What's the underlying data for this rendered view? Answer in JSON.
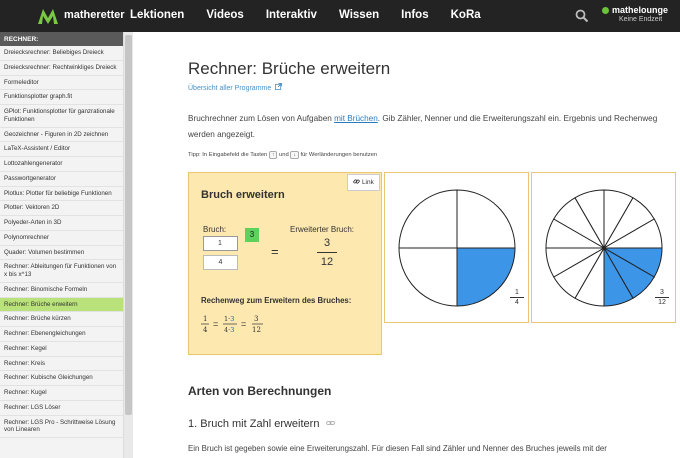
{
  "header": {
    "brand": "matheretter",
    "nav": [
      "Lektionen",
      "Videos",
      "Interaktiv",
      "Wissen",
      "Infos",
      "KoRa"
    ],
    "user_name": "mathelounge",
    "user_status": "Keine Endzeit"
  },
  "sidebar": {
    "heading": "RECHNER:",
    "items": [
      "Dreiecksrechner: Beliebiges Dreieck",
      "Dreiecksrechner: Rechtwinkliges Dreieck",
      "Formeleditor",
      "Funktionsplotter graph.fit",
      "GPlot: Funktionsplotter für ganzrationale Funktionen",
      "Geozeichner - Figuren in 2D zeichnen",
      "LaTeX-Assistent / Editor",
      "Lottozahlengenerator",
      "Passwortgenerator",
      "Plotlux: Plotter für beliebige Funktionen",
      "Plotter: Vektoren 2D",
      "Polyeder-Arten in 3D",
      "Polynomrechner",
      "Quader: Volumen bestimmen",
      "Rechner: Ableitungen für Funktionen von x bis x^13",
      "Rechner: Binomische Formeln",
      "Rechner: Brüche erweitern",
      "Rechner: Brüche kürzen",
      "Rechner: Ebenengleichungen",
      "Rechner: Kegel",
      "Rechner: Kreis",
      "Rechner: Kubische Gleichungen",
      "Rechner: Kugel",
      "Rechner: LGS Löser",
      "Rechner: LGS Pro - Schrittweise Lösung von Linearen"
    ],
    "active_index": 16
  },
  "main": {
    "title": "Rechner: Brüche erweitern",
    "overview_link": "Übersicht aller Programme",
    "intro_before": "Bruchrechner zum Lösen von Aufgaben ",
    "intro_link": "mit Brüchen",
    "intro_after": ". Gib Zähler, Nenner und die Erweiterungszahl ein. Ergebnis und Rechenweg werden angezeigt.",
    "tip_before": "Tipp: In Eingabefeld die Tasten",
    "tip_key_up": "↑",
    "tip_mid": "und",
    "tip_key_down": "↓",
    "tip_after": "für Werländerungen benutzen"
  },
  "calculator": {
    "title": "Bruch erweitern",
    "link_label": "Link",
    "bruch_label": "Bruch:",
    "numerator": "1",
    "denominator": "4",
    "factor": "3",
    "equals": "=",
    "extended_label": "Erweiterter Bruch:",
    "extended_numerator": "3",
    "extended_denominator": "12",
    "rechenweg_title": "Rechenweg zum Erweitern des Bruches:",
    "rw_n1": "1",
    "rw_d1": "4",
    "rw_n2a": "1",
    "rw_n2b": "3",
    "rw_d2a": "4",
    "rw_d2b": "3",
    "rw_n3": "3",
    "rw_d3": "12"
  },
  "pies": [
    {
      "slices": 4,
      "filled": 1,
      "num": "1",
      "den": "4"
    },
    {
      "slices": 12,
      "filled": 3,
      "num": "3",
      "den": "12"
    }
  ],
  "colors": {
    "pie_fill": "#3d95e8",
    "highlight": "#b9e27a",
    "panel": "#fde8b0"
  },
  "section": {
    "h2": "Arten von Berechnungen",
    "h3": "1. Bruch mit Zahl erweitern",
    "para": "Ein Bruch ist gegeben sowie eine Erweiterungszahl. Für diesen Fall sind Zähler und Nenner des Bruches jeweils mit der"
  }
}
